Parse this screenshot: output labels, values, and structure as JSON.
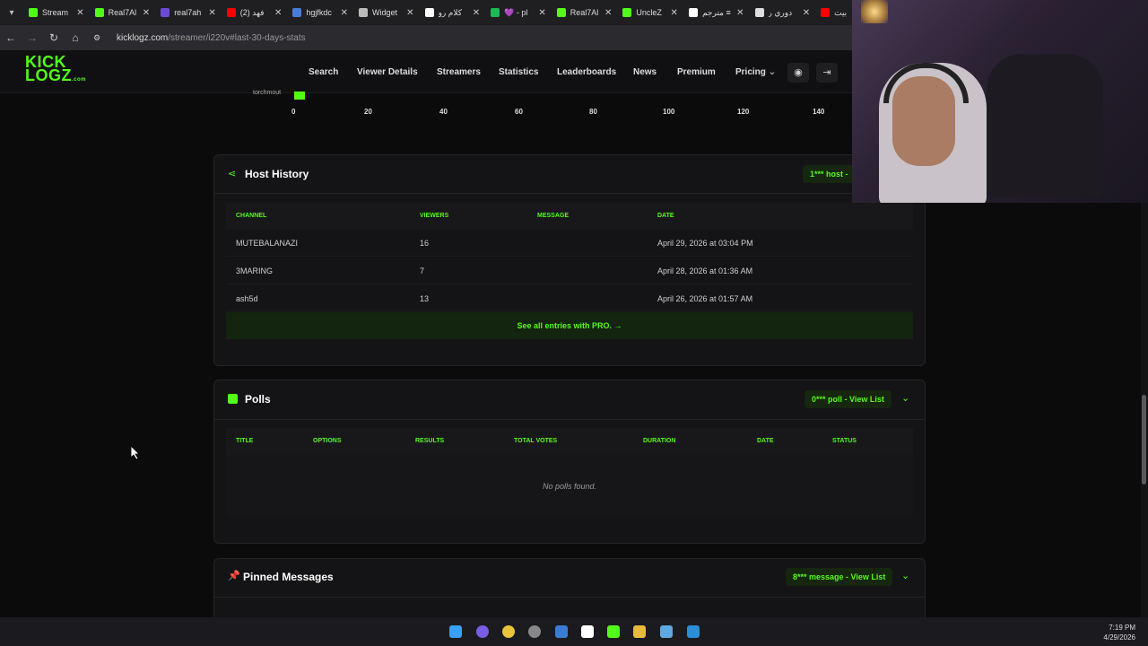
{
  "browser": {
    "tabs": [
      {
        "title": "Stream",
        "icon": "kick-icon",
        "color": "#53fc18"
      },
      {
        "title": "Real7Al",
        "icon": "kick-icon",
        "color": "#53fc18"
      },
      {
        "title": "real7ah",
        "icon": "c-icon",
        "color": "#6b4bd6"
      },
      {
        "title": "(2) فهد",
        "icon": "youtube-icon",
        "color": "#ff0000"
      },
      {
        "title": "hgjfkdc",
        "icon": "r-icon",
        "color": "#4a7bd6"
      },
      {
        "title": "Widget",
        "icon": "widget-icon",
        "color": "#bbbbbb"
      },
      {
        "title": "كلام رو",
        "icon": "google-icon",
        "color": "#ffffff"
      },
      {
        "title": "💜 - pl",
        "icon": "spotify-icon",
        "color": "#1db954"
      },
      {
        "title": "Real7Al",
        "icon": "kick-icon",
        "color": "#53fc18"
      },
      {
        "title": "UncleZ",
        "icon": "kick-icon",
        "color": "#53fc18"
      },
      {
        "title": "مترجم ≡",
        "icon": "google-icon",
        "color": "#ffffff"
      },
      {
        "title": "دوري ر",
        "icon": "x-icon",
        "color": "#dddddd"
      },
      {
        "title": "بيت",
        "icon": "youtube-icon",
        "color": "#ff0000"
      }
    ],
    "url_host": "kicklogz.com",
    "url_path": "/streamer/i220v#last-30-days-stats"
  },
  "site": {
    "logo_line1": "KICK",
    "logo_line2": "LOGZ",
    "logo_suffix": ".com",
    "menu": [
      "Search",
      "Viewer Details",
      "Streamers",
      "Statistics",
      "Leaderboards",
      "News",
      "Premium",
      "Pricing"
    ]
  },
  "chart": {
    "partial_label": "torchmout",
    "ticks": [
      "0",
      "20",
      "40",
      "60",
      "80",
      "100",
      "120",
      "140"
    ]
  },
  "host_history": {
    "title": "Host History",
    "pill": "1*** host -",
    "headers": [
      "CHANNEL",
      "VIEWERS",
      "MESSAGE",
      "DATE"
    ],
    "rows": [
      {
        "channel": "MUTEBALANAZI",
        "viewers": "16",
        "message": "",
        "date": "April 29, 2026 at 03:04 PM"
      },
      {
        "channel": "3MARING",
        "viewers": "7",
        "message": "",
        "date": "April 28, 2026 at 01:36 AM"
      },
      {
        "channel": "ash5d",
        "viewers": "13",
        "message": "",
        "date": "April 26, 2026 at 01:57 AM"
      }
    ],
    "see_all": "See all entries with PRO. →"
  },
  "polls": {
    "title": "Polls",
    "pill": "0*** poll - View List",
    "headers": [
      "TITLE",
      "OPTIONS",
      "RESULTS",
      "TOTAL VOTES",
      "DURATION",
      "DATE",
      "STATUS"
    ],
    "empty": "No polls found."
  },
  "pinned": {
    "title": "Pinned Messages",
    "pill": "8*** message - View List"
  },
  "clock": {
    "time": "7:19 PM",
    "date": "4/29/2026"
  }
}
